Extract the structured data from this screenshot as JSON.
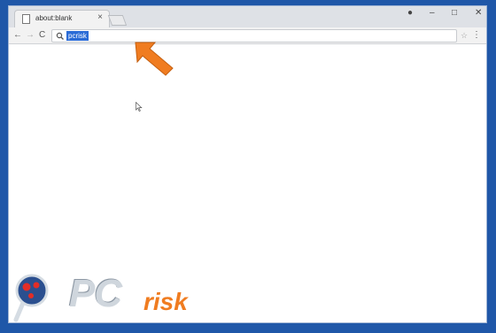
{
  "browser": {
    "tab_title": "about:blank",
    "tab_close": "×",
    "controls": {
      "account": "●",
      "minimize": "–",
      "maximize": "□",
      "close": "✕"
    }
  },
  "toolbar": {
    "back": "←",
    "forward": "→",
    "reload": "C",
    "address_value": "pcrisk",
    "bookmark_star": "☆",
    "menu": "⋮"
  },
  "watermark": {
    "brand": "PC",
    "suffix": "risk"
  },
  "colors": {
    "background": "#1f57a8",
    "selection": "#2a6bd6",
    "arrow": "#f07c20",
    "logo_accent": "#e32d27"
  }
}
